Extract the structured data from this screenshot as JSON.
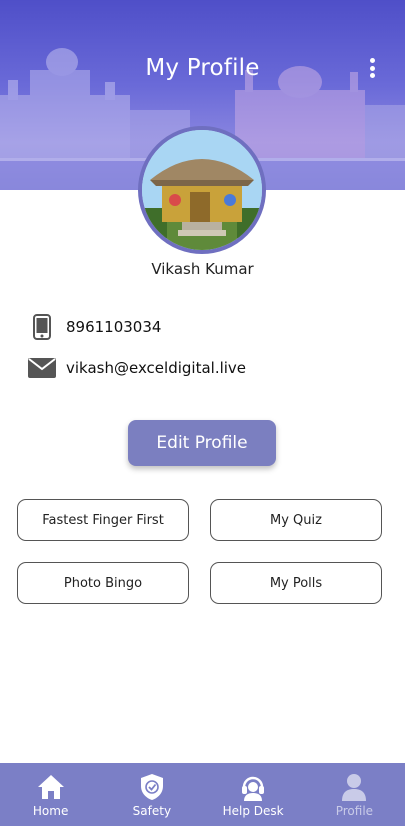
{
  "header": {
    "title": "My Profile"
  },
  "profile": {
    "name": "Vikash Kumar",
    "phone": "8961103034",
    "email": "vikash@exceldigital.live"
  },
  "actions": {
    "edit_label": "Edit Profile",
    "options": [
      "Fastest Finger First",
      "My Quiz",
      "Photo Bingo",
      "My Polls"
    ]
  },
  "nav": {
    "items": [
      {
        "label": "Home",
        "icon": "home-icon"
      },
      {
        "label": "Safety",
        "icon": "shield-icon"
      },
      {
        "label": "Help Desk",
        "icon": "headset-icon"
      },
      {
        "label": "Profile",
        "icon": "person-icon"
      }
    ],
    "active": "Profile"
  },
  "colors": {
    "header": "#5b5bd0",
    "accent": "#7b7fc0",
    "nav_bg": "#7b7fc6",
    "avatar_border": "#6f6fc0"
  }
}
